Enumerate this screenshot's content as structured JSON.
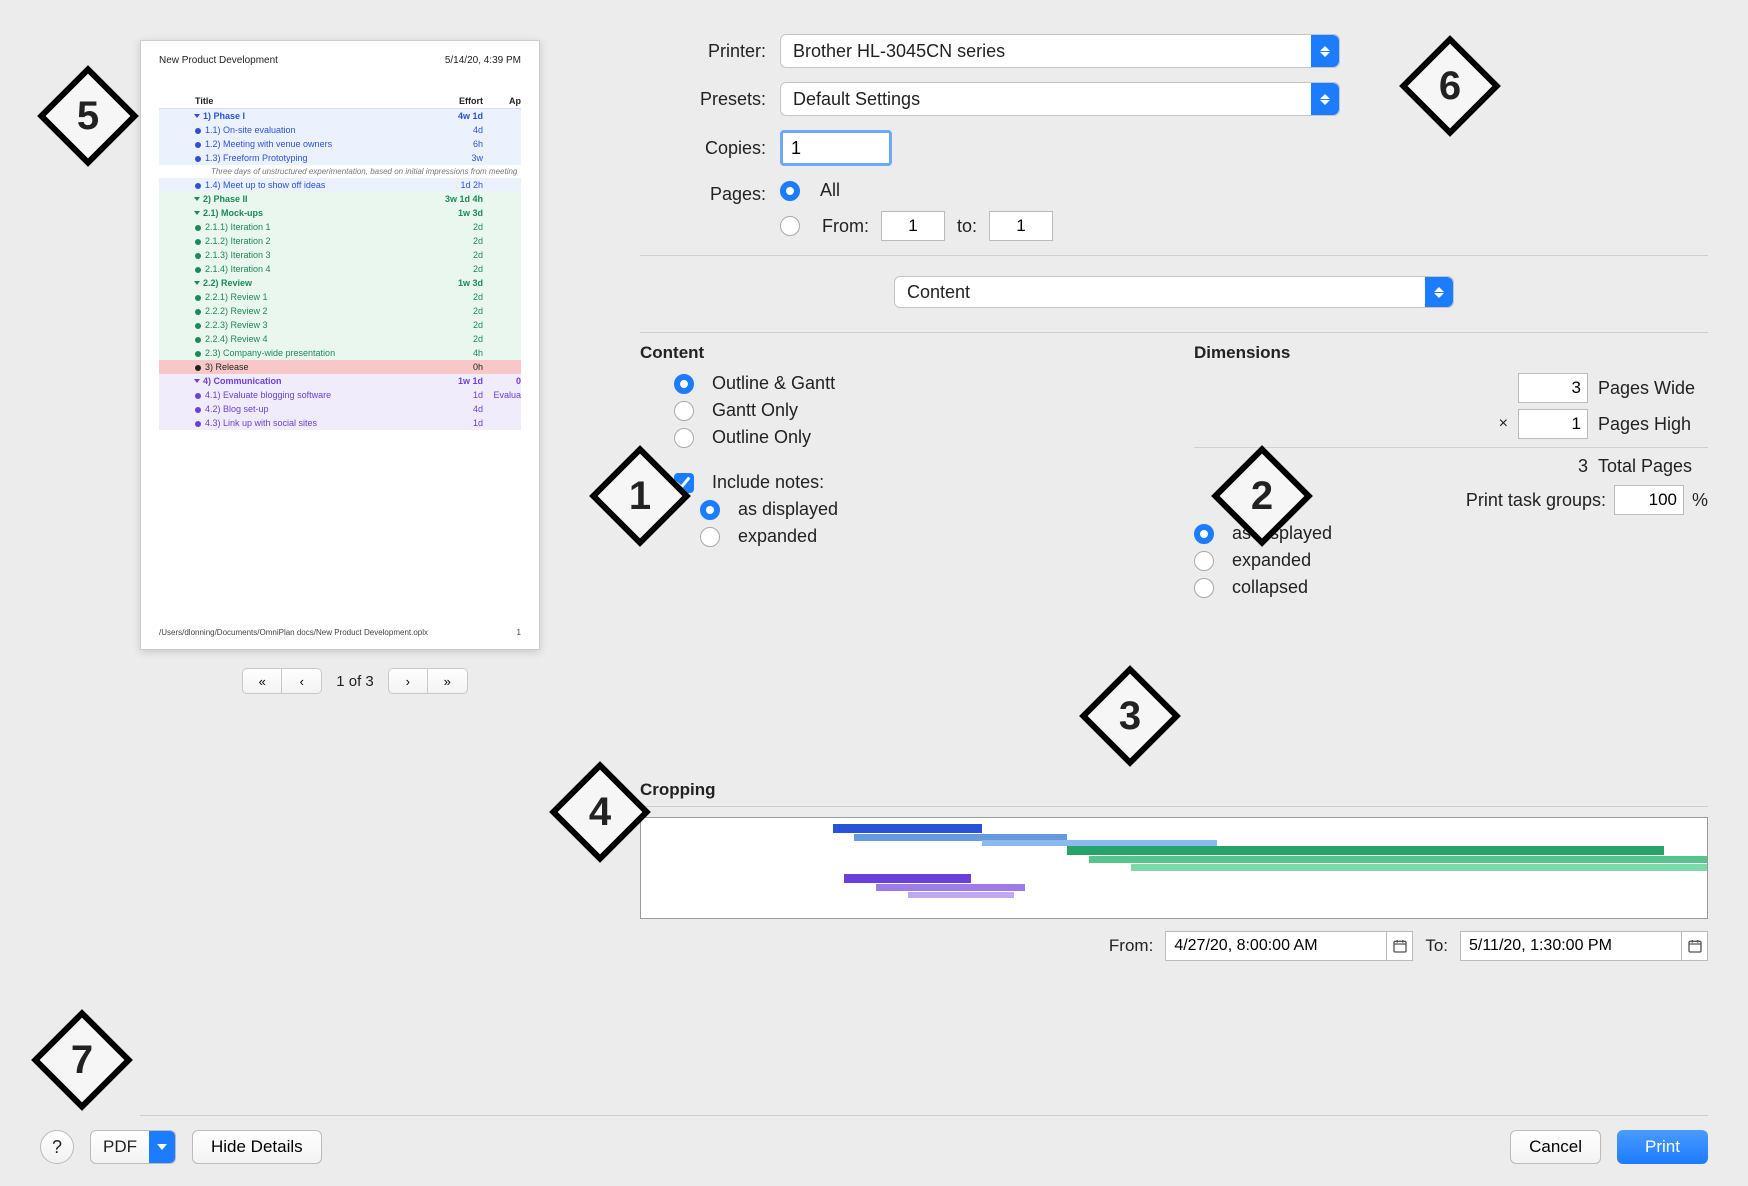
{
  "annotations": {
    "a1": "1",
    "a2": "2",
    "a3": "3",
    "a4": "4",
    "a5": "5",
    "a6": "6",
    "a7": "7"
  },
  "preview": {
    "title": "New Product Development",
    "timestamp": "5/14/20, 4:39 PM",
    "cols": {
      "title": "Title",
      "effort": "Effort",
      "ap": "Ap"
    },
    "footer_path": "/Users/dlonning/Documents/OmniPlan docs/New Product Development.oplx",
    "footer_page": "1",
    "rows": [
      {
        "cls": "blue bold",
        "tri": true,
        "t": "1)  Phase I",
        "e": "4w 1d"
      },
      {
        "cls": "blue",
        "disc": true,
        "t": "1.1)  On-site evaluation",
        "e": "4d"
      },
      {
        "cls": "blue",
        "disc": true,
        "t": "1.2)  Meeting with venue owners",
        "e": "6h"
      },
      {
        "cls": "blue",
        "disc": true,
        "t": "1.3)  Freeform Prototyping",
        "e": "3w"
      },
      {
        "cls": "note",
        "t": "Three days of unstructured experimentation, based on initial impressions from meeting"
      },
      {
        "cls": "blue",
        "disc": true,
        "t": "1.4)  Meet up to show off ideas",
        "e": "1d 2h"
      },
      {
        "cls": "green bold",
        "tri": true,
        "t": "2)  Phase II",
        "e": "3w 1d 4h"
      },
      {
        "cls": "green bold",
        "tri": true,
        "t": "2.1)  Mock-ups",
        "e": "1w 3d"
      },
      {
        "cls": "green",
        "disc": true,
        "t": "2.1.1)  Iteration 1",
        "e": "2d"
      },
      {
        "cls": "green",
        "disc": true,
        "t": "2.1.2)  Iteration 2",
        "e": "2d"
      },
      {
        "cls": "green",
        "disc": true,
        "t": "2.1.3)  Iteration 3",
        "e": "2d"
      },
      {
        "cls": "green",
        "disc": true,
        "t": "2.1.4)  Iteration 4",
        "e": "2d"
      },
      {
        "cls": "green bold",
        "tri": true,
        "t": "2.2)  Review",
        "e": "1w 3d"
      },
      {
        "cls": "green",
        "disc": true,
        "t": "2.2.1)  Review 1",
        "e": "2d"
      },
      {
        "cls": "green",
        "disc": true,
        "t": "2.2.2)  Review 2",
        "e": "2d"
      },
      {
        "cls": "green",
        "disc": true,
        "t": "2.2.3)  Review 3",
        "e": "2d"
      },
      {
        "cls": "green",
        "disc": true,
        "t": "2.2.4)  Review 4",
        "e": "2d"
      },
      {
        "cls": "green",
        "disc": true,
        "t": "2.3)  Company-wide presentation",
        "e": "4h"
      },
      {
        "cls": "red",
        "disc": true,
        "t": "3)  Release",
        "e": "0h"
      },
      {
        "cls": "purple bold",
        "tri": true,
        "t": "4)  Communication",
        "e": "1w 1d",
        "ap": "0"
      },
      {
        "cls": "purple",
        "disc": true,
        "t": "4.1)  Evaluate blogging software",
        "e": "1d",
        "ap": "Evalua"
      },
      {
        "cls": "purple",
        "disc": true,
        "t": "4.2)  Blog set-up",
        "e": "4d"
      },
      {
        "cls": "purple",
        "disc": true,
        "t": "4.3)  Link up with social sites",
        "e": "1d"
      }
    ]
  },
  "pager": {
    "first": "«",
    "prev": "‹",
    "label": "1 of 3",
    "next": "›",
    "last": "»"
  },
  "form": {
    "printer_label": "Printer:",
    "printer_value": "Brother HL-3045CN series",
    "presets_label": "Presets:",
    "presets_value": "Default Settings",
    "copies_label": "Copies:",
    "copies_value": "1",
    "pages_label": "Pages:",
    "pages_all": "All",
    "pages_from": "From:",
    "pages_from_val": "1",
    "pages_to": "to:",
    "pages_to_val": "1",
    "section_value": "Content"
  },
  "content": {
    "heading": "Content",
    "opt1": "Outline & Gantt",
    "opt2": "Gantt Only",
    "opt3": "Outline Only",
    "include_notes": "Include notes:",
    "notes1": "as displayed",
    "notes2": "expanded"
  },
  "dimensions": {
    "heading": "Dimensions",
    "wide_val": "3",
    "wide_lbl": "Pages Wide",
    "x": "×",
    "high_val": "1",
    "high_lbl": "Pages High",
    "total_val": "3",
    "total_lbl": "Total Pages",
    "taskgroups_lbl": "Print task groups:",
    "taskgroups_val": "100",
    "pct": "%",
    "tg1": "as displayed",
    "tg2": "expanded",
    "tg3": "collapsed"
  },
  "cropping": {
    "heading": "Cropping",
    "from_lbl": "From:",
    "from_val": "4/27/20, 8:00:00 AM",
    "to_lbl": "To:",
    "to_val": "5/11/20, 1:30:00 PM"
  },
  "bottom": {
    "pdf": "PDF",
    "hide": "Hide Details",
    "cancel": "Cancel",
    "print": "Print",
    "help": "?"
  }
}
